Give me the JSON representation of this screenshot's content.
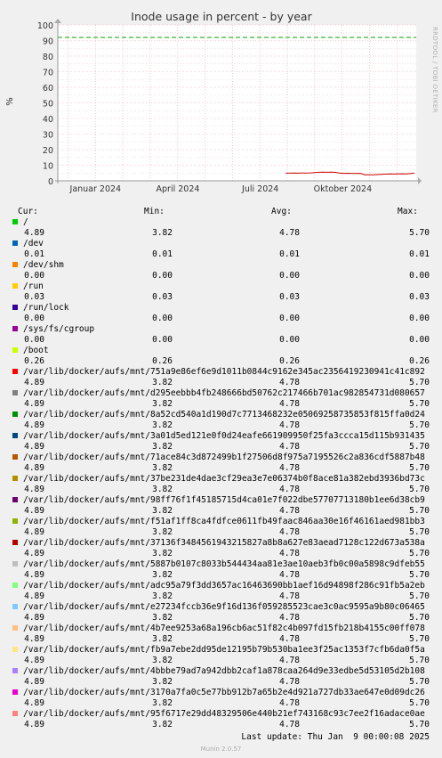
{
  "colors": {
    "background": "#f0f0f0",
    "plot_background": "#ffffff",
    "grid_major": "#e8a0a0",
    "grid_minor": "#e0c8c8",
    "warning_line": "#00aa00",
    "series_line": "#cc0000"
  },
  "chart_data": {
    "type": "line",
    "title": "Inode usage in percent - by year",
    "ylabel": "%",
    "ylim": [
      0,
      100
    ],
    "y_ticks": [
      "0",
      "10",
      "20",
      "30",
      "40",
      "50",
      "60",
      "70",
      "80",
      "90",
      "100"
    ],
    "x_ticks": [
      {
        "label": "Januar 2024",
        "pos": 0.105
      },
      {
        "label": "April 2024",
        "pos": 0.335
      },
      {
        "label": "Juli 2024",
        "pos": 0.565
      },
      {
        "label": "Oktober 2024",
        "pos": 0.795
      }
    ],
    "grid": true,
    "warning_level": 92,
    "series": [
      {
        "start": 0.636,
        "values": [
          4.89,
          4.9,
          4.95,
          4.92,
          5.0,
          4.95,
          5.1,
          5.3,
          5.5,
          5.6,
          5.5,
          5.55,
          5.45,
          4.9,
          4.8,
          4.85,
          4.7,
          4.75,
          4.8,
          3.9,
          3.82,
          3.85,
          4.0,
          4.1,
          4.3,
          4.4,
          4.35,
          4.45,
          4.5,
          4.4,
          4.6,
          4.89
        ]
      }
    ]
  },
  "legend": {
    "headers": {
      "cur": "Cur:",
      "min": "Min:",
      "avg": "Avg:",
      "max": "Max:"
    },
    "items": [
      {
        "color": "#00cc00",
        "label": "/",
        "cur": "4.89",
        "min": "3.82",
        "avg": "4.78",
        "max": "5.70"
      },
      {
        "color": "#0066b3",
        "label": "/dev",
        "cur": "0.01",
        "min": "0.01",
        "avg": "0.01",
        "max": "0.01"
      },
      {
        "color": "#ff8000",
        "label": "/dev/shm",
        "cur": "0.00",
        "min": "0.00",
        "avg": "0.00",
        "max": "0.00"
      },
      {
        "color": "#ffcc00",
        "label": "/run",
        "cur": "0.03",
        "min": "0.03",
        "avg": "0.03",
        "max": "0.03"
      },
      {
        "color": "#330099",
        "label": "/run/lock",
        "cur": "0.00",
        "min": "0.00",
        "avg": "0.00",
        "max": "0.00"
      },
      {
        "color": "#990099",
        "label": "/sys/fs/cgroup",
        "cur": "0.00",
        "min": "0.00",
        "avg": "0.00",
        "max": "0.00"
      },
      {
        "color": "#ccff00",
        "label": "/boot",
        "cur": "0.26",
        "min": "0.26",
        "avg": "0.26",
        "max": "0.26"
      },
      {
        "color": "#ff0000",
        "label": "/var/lib/docker/aufs/mnt/751a9e86ef6e9d1011b0844c9162e345ac2356419230941c41c892",
        "cur": "4.89",
        "min": "3.82",
        "avg": "4.78",
        "max": "5.70"
      },
      {
        "color": "#808080",
        "label": "/var/lib/docker/aufs/mnt/d295eebbb4fb248666bd50762c217466b701ac982854731d080657",
        "cur": "4.89",
        "min": "3.82",
        "avg": "4.78",
        "max": "5.70"
      },
      {
        "color": "#008f00",
        "label": "/var/lib/docker/aufs/mnt/8a52cd540a1d190d7c7713468232e05069258735853f815ffa0d24",
        "cur": "4.89",
        "min": "3.82",
        "avg": "4.78",
        "max": "5.70"
      },
      {
        "color": "#00487d",
        "label": "/var/lib/docker/aufs/mnt/3a01d5ed121e0f0d24eafe661909950f25fa3ccca15d115b931435",
        "cur": "4.89",
        "min": "3.82",
        "avg": "4.78",
        "max": "5.70"
      },
      {
        "color": "#b35a00",
        "label": "/var/lib/docker/aufs/mnt/71ace84c3d872499b1f27506d8f975a7195526c2a836cdf5887b48",
        "cur": "4.89",
        "min": "3.82",
        "avg": "4.78",
        "max": "5.70"
      },
      {
        "color": "#b38f00",
        "label": "/var/lib/docker/aufs/mnt/37be231de4dae3cf29ea3e7e06374b0f8ace81a382ebd3936bd73c",
        "cur": "4.89",
        "min": "3.82",
        "avg": "4.78",
        "max": "5.70"
      },
      {
        "color": "#6b006b",
        "label": "/var/lib/docker/aufs/mnt/98ff76f1f45185715d4ca01e7f022dbe57707713180b1ee6d38cb9",
        "cur": "4.89",
        "min": "3.82",
        "avg": "4.78",
        "max": "5.70"
      },
      {
        "color": "#8fb300",
        "label": "/var/lib/docker/aufs/mnt/f51af1ff8ca4fdfce0611fb49faac846aa30e16f46161aed981bb3",
        "cur": "4.89",
        "min": "3.82",
        "avg": "4.78",
        "max": "5.70"
      },
      {
        "color": "#b30000",
        "label": "/var/lib/docker/aufs/mnt/37136f3484561943215827a8b8a627e83aead7128c122d673a538a",
        "cur": "4.89",
        "min": "3.82",
        "avg": "4.78",
        "max": "5.70"
      },
      {
        "color": "#bebebe",
        "label": "/var/lib/docker/aufs/mnt/5887b0107c8033b544434aa81e3ae10aeb3fb0c00a5898c9dfeb55",
        "cur": "4.89",
        "min": "3.82",
        "avg": "4.78",
        "max": "5.70"
      },
      {
        "color": "#80ff80",
        "label": "/var/lib/docker/aufs/mnt/adc95a79f3dd3657ac16463690bb1aef16d94898f286c91fb5a2eb",
        "cur": "4.89",
        "min": "3.82",
        "avg": "4.78",
        "max": "5.70"
      },
      {
        "color": "#80c9ff",
        "label": "/var/lib/docker/aufs/mnt/e27234fccb36e9f16d136f059285523cae3c0ac9595a9b80c06465",
        "cur": "4.89",
        "min": "3.82",
        "avg": "4.78",
        "max": "5.70"
      },
      {
        "color": "#ffc080",
        "label": "/var/lib/docker/aufs/mnt/4b7ee9253a68a196cb6ac51f82c4b097fd15fb218b4155c00ff078",
        "cur": "4.89",
        "min": "3.82",
        "avg": "4.78",
        "max": "5.70"
      },
      {
        "color": "#ffe680",
        "label": "/var/lib/docker/aufs/mnt/fb9a7ebe2dd95de12195b79b530ba1ee3f25ac1353f7cfb6da0f5a",
        "cur": "4.89",
        "min": "3.82",
        "avg": "4.78",
        "max": "5.70"
      },
      {
        "color": "#aa80ff",
        "label": "/var/lib/docker/aufs/mnt/4bbbe79ad7a942dbb2caf1a878caa264d9e33edbe5d53105d2b108",
        "cur": "4.89",
        "min": "3.82",
        "avg": "4.78",
        "max": "5.70"
      },
      {
        "color": "#ee00cc",
        "label": "/var/lib/docker/aufs/mnt/3170a7fa0c5e77bb912b7a65b2e4d921a727db33ae647e0d09dc26",
        "cur": "4.89",
        "min": "3.82",
        "avg": "4.78",
        "max": "5.70"
      },
      {
        "color": "#ff8080",
        "label": "/var/lib/docker/aufs/mnt/95f6717e29dd48329506e440b21ef743168c93c7ee2f16adace0ae",
        "cur": "4.89",
        "min": "3.82",
        "avg": "4.78",
        "max": "5.70"
      }
    ]
  },
  "footer": {
    "last_update": "Last update: Thu Jan  9 00:00:08 2025",
    "munin": "Munin 2.0.57",
    "rrdtool": "RRDTOOL / TOBI OETIKER"
  }
}
